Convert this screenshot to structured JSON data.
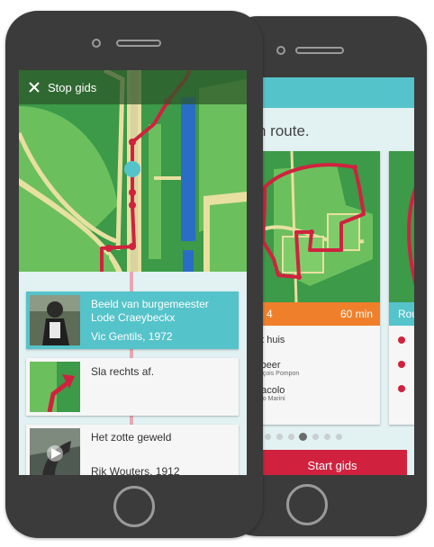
{
  "colors": {
    "teal": "#55c3ca",
    "red": "#d0223f",
    "orange": "#f07f2b",
    "map_green_dark": "#3c9a48",
    "map_green_light": "#6cbf5d",
    "map_path": "#e7e0a0",
    "map_water": "#2a6dc4",
    "phone_body": "#3b3b3b"
  },
  "front": {
    "header": {
      "close_icon": "close-icon",
      "title": "Stop gids"
    },
    "stops": [
      {
        "thumb": "statue-photo",
        "title_line1": "Beeld van burgemeester",
        "title_line2": "Lode Craeybeckx",
        "subtitle": "Vic Gentils, 1972",
        "active": true
      },
      {
        "thumb": "mini-map-arrow",
        "title_line1": "Sla rechts af.",
        "title_line2": "",
        "subtitle": "",
        "active": false
      },
      {
        "thumb": "sculpture-video",
        "title_line1": "Het zotte geweld",
        "title_line2": "",
        "subtitle": "Rik Wouters, 1912",
        "active": false
      }
    ]
  },
  "back": {
    "heading": "n route.",
    "route_card": {
      "label": "e 4",
      "duration": "60 min"
    },
    "route_items": [
      {
        "title": "et huis",
        "sub": ""
      },
      {
        "title": "sbeer",
        "sub": "ançois Pompon"
      },
      {
        "title": "iracolo",
        "sub": "rino Marini"
      }
    ],
    "second_card_label": "Rou",
    "pager": {
      "count": 7,
      "active": 3
    },
    "start_button": "Start gids"
  }
}
